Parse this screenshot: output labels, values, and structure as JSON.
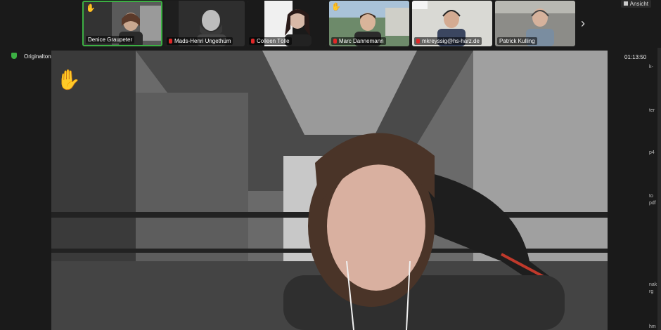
{
  "participants": [
    {
      "name": "Denice Graupeter",
      "hand": true,
      "muted": false,
      "active": true
    },
    {
      "name": "Mads-Henri Ungethüm",
      "hand": true,
      "muted": true,
      "active": false
    },
    {
      "name": "Colleen Tölle",
      "hand": true,
      "muted": true,
      "active": false
    },
    {
      "name": "Marc Dannemann",
      "hand": true,
      "muted": true,
      "active": false
    },
    {
      "name": "mkreyssig@hs-harz.de",
      "hand": false,
      "muted": true,
      "active": false
    },
    {
      "name": "Patrick Kulling",
      "hand": false,
      "muted": false,
      "active": false
    }
  ],
  "view_button": "Ansicht",
  "original_audio": "Originalton: Ein",
  "timer": "01:13:50",
  "side_fragments": [
    "k-",
    "ter",
    "p4",
    "to",
    "pdf",
    "nak",
    "rg",
    "hm"
  ],
  "icons": {
    "hand": "raised-hand-icon",
    "next": "chevron-right-icon",
    "shield": "shield-icon",
    "mic": "mic-muted-icon",
    "view": "grid-view-icon"
  },
  "colors": {
    "active_border": "#3cb043",
    "mute_red": "#e02828",
    "background": "#1a1a1a"
  }
}
